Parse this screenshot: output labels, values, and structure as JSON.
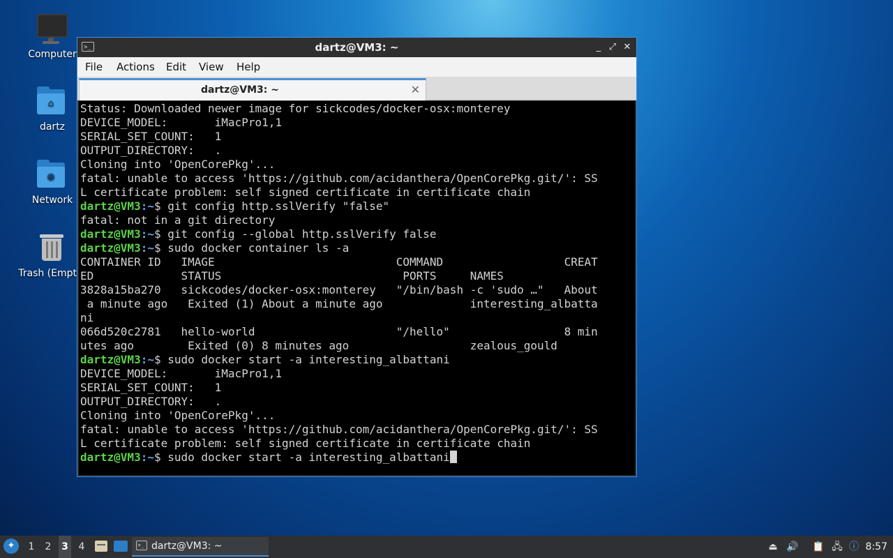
{
  "desktop": {
    "icons": [
      {
        "label": "Computer"
      },
      {
        "label": "dartz"
      },
      {
        "label": "Network"
      },
      {
        "label": "Trash (Empty)"
      }
    ]
  },
  "window": {
    "title": "dartz@VM3: ~",
    "app_icon": ">_",
    "controls": {
      "minimize": "_",
      "maximize": "⤢",
      "close": "✕"
    },
    "menu": [
      "File",
      "Actions",
      "Edit",
      "View",
      "Help"
    ],
    "tab": {
      "label": "dartz@VM3: ~",
      "close": "✕"
    }
  },
  "terminal": {
    "prompt_user": "dartz@VM3",
    "prompt_sep": ":",
    "prompt_path": "~",
    "prompt_end": "$ ",
    "lines": [
      {
        "text": "Status: Downloaded newer image for sickcodes/docker-osx:monterey"
      },
      {
        "text": "DEVICE_MODEL:       iMacPro1,1"
      },
      {
        "text": "SERIAL_SET_COUNT:   1"
      },
      {
        "text": "OUTPUT_DIRECTORY:   ."
      },
      {
        "text": "Cloning into 'OpenCorePkg'..."
      },
      {
        "text": "fatal: unable to access 'https://github.com/acidanthera/OpenCorePkg.git/': SS"
      },
      {
        "text": "L certificate problem: self signed certificate in certificate chain"
      },
      {
        "cmd": "git config http.sslVerify \"false\""
      },
      {
        "text": "fatal: not in a git directory"
      },
      {
        "cmd": "git config --global http.sslVerify false"
      },
      {
        "cmd": "sudo docker container ls -a"
      },
      {
        "text": "CONTAINER ID   IMAGE                           COMMAND                  CREAT"
      },
      {
        "text": "ED             STATUS                           PORTS     NAMES"
      },
      {
        "text": "3828a15ba270   sickcodes/docker-osx:monterey   \"/bin/bash -c 'sudo …\"   About"
      },
      {
        "text": " a minute ago   Exited (1) About a minute ago             interesting_albatta"
      },
      {
        "text": "ni"
      },
      {
        "text": "066d520c2781   hello-world                     \"/hello\"                 8 min"
      },
      {
        "text": "utes ago        Exited (0) 8 minutes ago                  zealous_gould"
      },
      {
        "cmd": "sudo docker start -a interesting_albattani"
      },
      {
        "text": "DEVICE_MODEL:       iMacPro1,1"
      },
      {
        "text": "SERIAL_SET_COUNT:   1"
      },
      {
        "text": "OUTPUT_DIRECTORY:   ."
      },
      {
        "text": "Cloning into 'OpenCorePkg'..."
      },
      {
        "text": "fatal: unable to access 'https://github.com/acidanthera/OpenCorePkg.git/': SS"
      },
      {
        "text": "L certificate problem: self signed certificate in certificate chain"
      },
      {
        "cmd": "sudo docker start -a interesting_albattani",
        "cursor": true
      }
    ]
  },
  "taskbar": {
    "workspaces": [
      "1",
      "2",
      "3",
      "4"
    ],
    "active_workspace": "3",
    "task_label": "dartz@VM3: ~",
    "clock": "8:57"
  },
  "colors": {
    "prompt_user": "#5bd24a",
    "prompt_path": "#6aa3e6",
    "accent": "#4a90d9"
  }
}
